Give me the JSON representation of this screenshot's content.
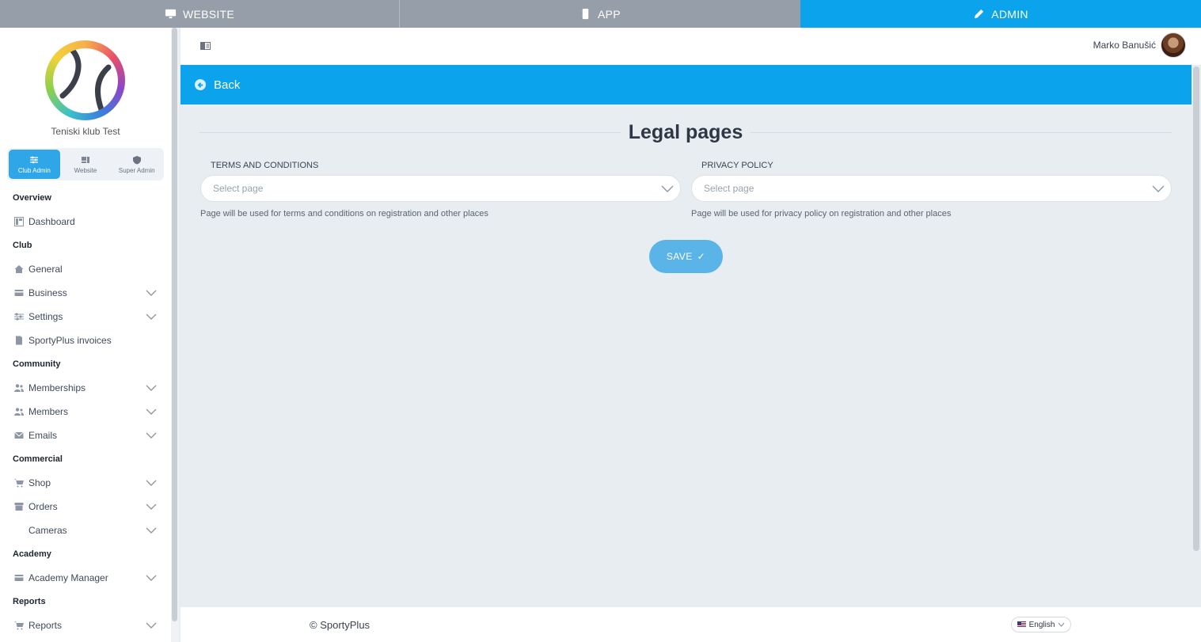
{
  "topbar": {
    "website_label": "WEBSITE",
    "app_label": "APP",
    "admin_label": "ADMIN"
  },
  "sidebar": {
    "club_name": "Teniski klub Test",
    "roles": [
      "Club Admin",
      "Website",
      "Super Admin"
    ],
    "sections": {
      "overview": "Overview",
      "club": "Club",
      "community": "Community",
      "commercial": "Commercial",
      "academy": "Academy",
      "reports": "Reports"
    },
    "items": {
      "dashboard": "Dashboard",
      "general": "General",
      "business": "Business",
      "settings": "Settings",
      "invoices": "SportyPlus invoices",
      "memberships": "Memberships",
      "members": "Members",
      "emails": "Emails",
      "shop": "Shop",
      "orders": "Orders",
      "cameras": "Cameras",
      "academy_manager": "Academy Manager",
      "reports": "Reports"
    }
  },
  "header": {
    "user_name": "Marko Banušić"
  },
  "main": {
    "back_label": "Back",
    "title": "Legal pages",
    "terms": {
      "label": "TERMS AND CONDITIONS",
      "placeholder": "Select page",
      "help": "Page will be used for terms and conditions on registration and other places"
    },
    "privacy": {
      "label": "PRIVACY POLICY",
      "placeholder": "Select page",
      "help": "Page will be used for privacy policy on registration and other places"
    },
    "save_label": "SAVE",
    "save_icon": "✓"
  },
  "footer": {
    "copyright": "© SportyPlus",
    "language": "English"
  },
  "colors": {
    "accent": "#0aa3ec",
    "topbar_inactive": "#969ea9",
    "save_button": "#5bb4e8",
    "page_bg": "#e8edf2"
  }
}
